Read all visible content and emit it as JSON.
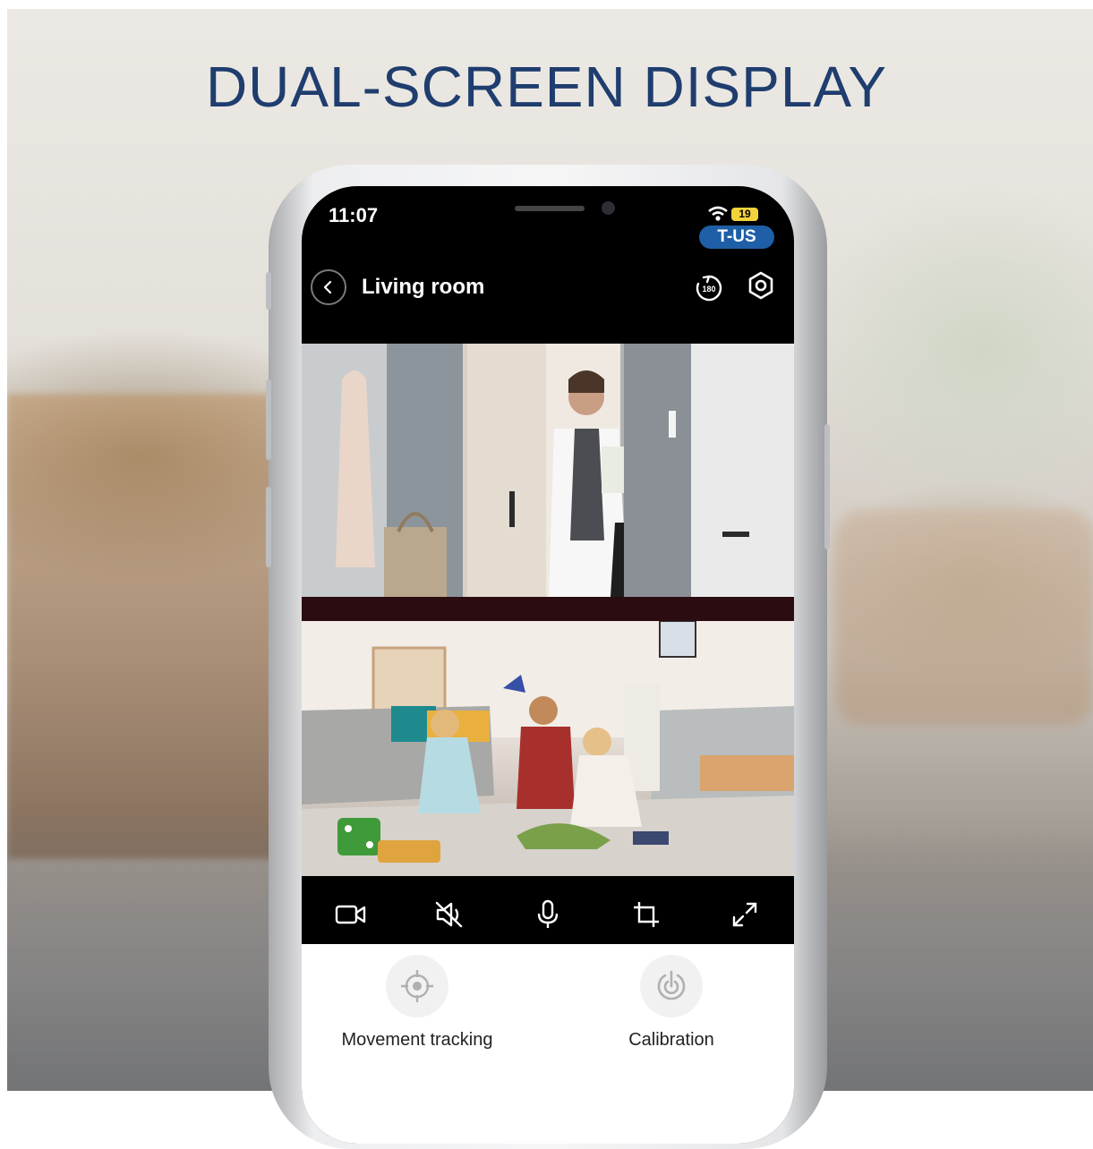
{
  "headline": "DUAL-SCREEN DISPLAY",
  "status_bar": {
    "time": "11:07",
    "battery": "19",
    "carrier": "T-US"
  },
  "header": {
    "title": "Living room",
    "back_icon": "chevron-left-icon",
    "rotate_icon": "rotate-180-icon",
    "rotate_label": "180",
    "settings_icon": "settings-hexagon-icon"
  },
  "feeds": [
    {
      "id": "camera-1",
      "scene": "entrance-door"
    },
    {
      "id": "camera-2",
      "scene": "living-room"
    }
  ],
  "controls": [
    {
      "id": "record",
      "icon": "video-camera-icon"
    },
    {
      "id": "mute",
      "icon": "speaker-muted-icon"
    },
    {
      "id": "talk",
      "icon": "microphone-icon"
    },
    {
      "id": "crop",
      "icon": "crop-icon"
    },
    {
      "id": "fullscreen",
      "icon": "expand-icon"
    }
  ],
  "features": [
    {
      "label": "Movement tracking",
      "icon": "crosshair-icon"
    },
    {
      "label": "Calibration",
      "icon": "calibration-icon"
    }
  ],
  "colors": {
    "headline": "#1f3d6e",
    "carrier_badge": "#1e5fa8",
    "battery": "#f3d33a",
    "screen": "#000000",
    "panel": "#ffffff"
  }
}
